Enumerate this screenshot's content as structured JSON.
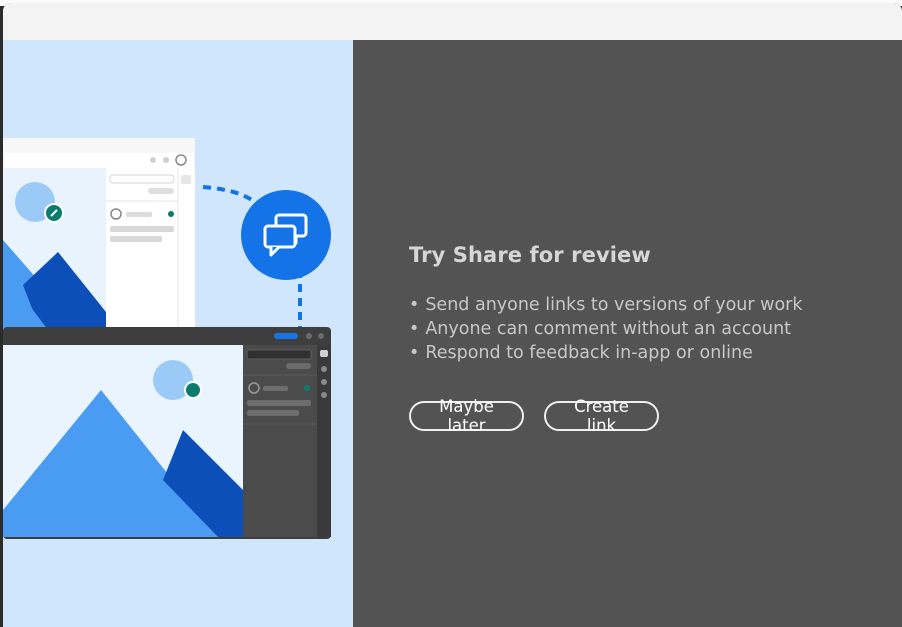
{
  "dialog": {
    "title": "Try Share for review",
    "bullets": [
      "Send anyone links to versions of your work",
      "Anyone can comment without an account",
      "Respond to feedback in-app or online"
    ],
    "bullet_glyph": "•",
    "buttons": {
      "maybe_later": "Maybe later",
      "create_link": "Create link"
    }
  },
  "colors": {
    "illustration_bg": "#cfe6fd",
    "panel_bg": "#535353",
    "accent_blue": "#1473e6",
    "teal": "#0d7c6c"
  },
  "icons": [
    "comment-bubbles-icon",
    "pin-icon",
    "avatar-icon"
  ]
}
